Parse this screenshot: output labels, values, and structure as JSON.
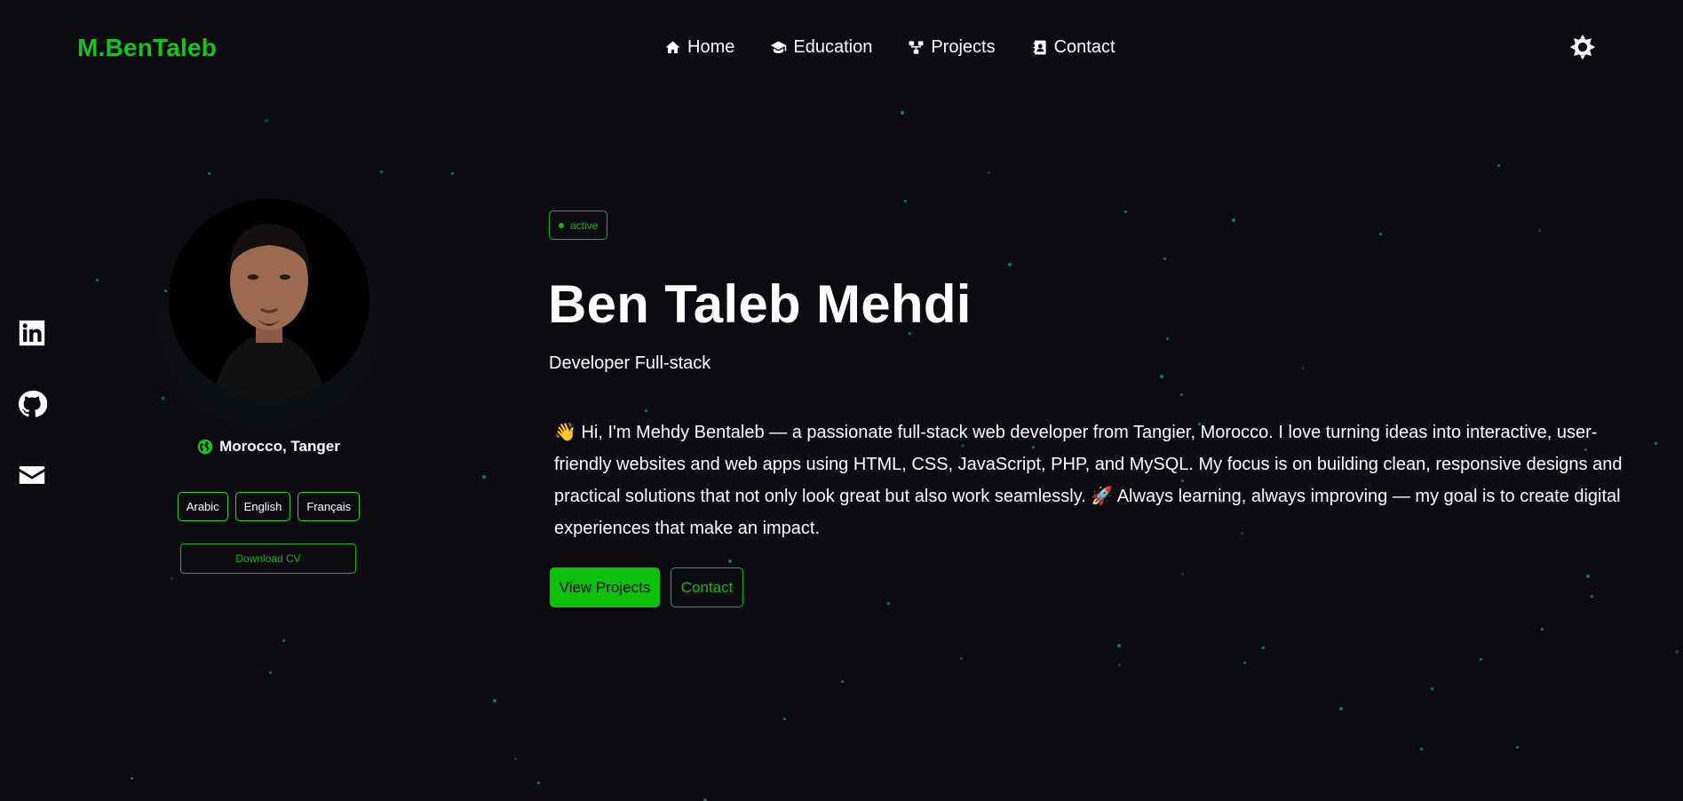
{
  "header": {
    "brand": "M.BenTaleb",
    "nav": [
      {
        "label": "Home",
        "icon": "home-icon"
      },
      {
        "label": "Education",
        "icon": "graduation-cap-icon"
      },
      {
        "label": "Projects",
        "icon": "sitemap-icon"
      },
      {
        "label": "Contact",
        "icon": "address-book-icon"
      }
    ],
    "theme_toggle_icon": "sun-icon"
  },
  "social": [
    {
      "name": "LinkedIn",
      "icon": "linkedin-icon"
    },
    {
      "name": "GitHub",
      "icon": "github-icon"
    },
    {
      "name": "Email",
      "icon": "envelope-icon"
    }
  ],
  "profile": {
    "location": "Morocco, Tanger",
    "languages": [
      "Arabic",
      "English",
      "Français"
    ],
    "cv_button": "Download CV"
  },
  "hero": {
    "status": "active",
    "name": "Ben Taleb Mehdi",
    "role": "Developer Full-stack",
    "intro": "👋 Hi, I'm Mehdy Bentaleb — a passionate full-stack web developer from Tangier, Morocco. I love turning ideas into interactive, user-friendly websites and web apps using HTML, CSS, JavaScript, PHP, and MySQL. My focus is on building clean, responsive designs and practical solutions that not only look great but also work seamlessly. 🚀 Always learning, always improving — my goal is to create digital experiences that make an impact.",
    "primary_button": "View Projects",
    "secondary_button": "Contact"
  },
  "colors": {
    "accent": "#17c41b",
    "background": "#0b0b10",
    "text": "#ffffff",
    "particles": "#1f8f6a"
  }
}
